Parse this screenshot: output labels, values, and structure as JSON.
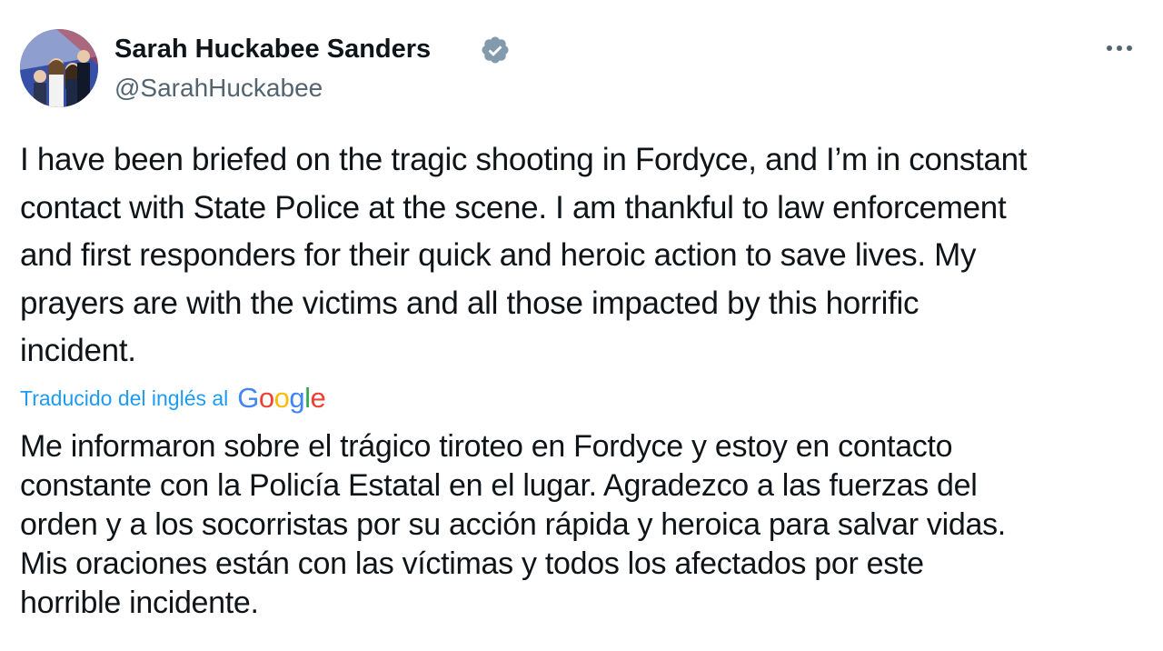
{
  "author": {
    "name": "Sarah Huckabee Sanders",
    "handle": "@SarahHuckabee",
    "avatar_icon": "profile-photo",
    "verified_icon": "verified-badge-icon",
    "verified_color": "#829aab"
  },
  "menu": {
    "more_icon": "more-options-icon"
  },
  "tweet": {
    "lines": [
      "I have been briefed on the tragic shooting in Fordyce, and I’m in constant",
      "contact with State Police at the scene. I am thankful to law enforcement",
      "and first responders for their quick and heroic action to save lives. My",
      "prayers are with the victims and all those impacted by this horrific",
      "incident."
    ]
  },
  "translation": {
    "label": "Traducido del inglés al",
    "provider_letters": [
      "G",
      "o",
      "o",
      "g",
      "l",
      "e"
    ],
    "provider_colors": [
      "#4285F4",
      "#EA4335",
      "#FBBC05",
      "#4285F4",
      "#34A853",
      "#EA4335"
    ],
    "lines": [
      "Me informaron sobre el trágico tiroteo en Fordyce y estoy en contacto",
      "constante con la Policía Estatal en el lugar. Agradezco a las fuerzas del",
      "orden y a los socorristas por su acción rápida y heroica para salvar vidas.",
      "Mis oraciones están con las víctimas y todos los afectados por este",
      "horrible incidente."
    ],
    "link_color": "#1d9bf0"
  }
}
